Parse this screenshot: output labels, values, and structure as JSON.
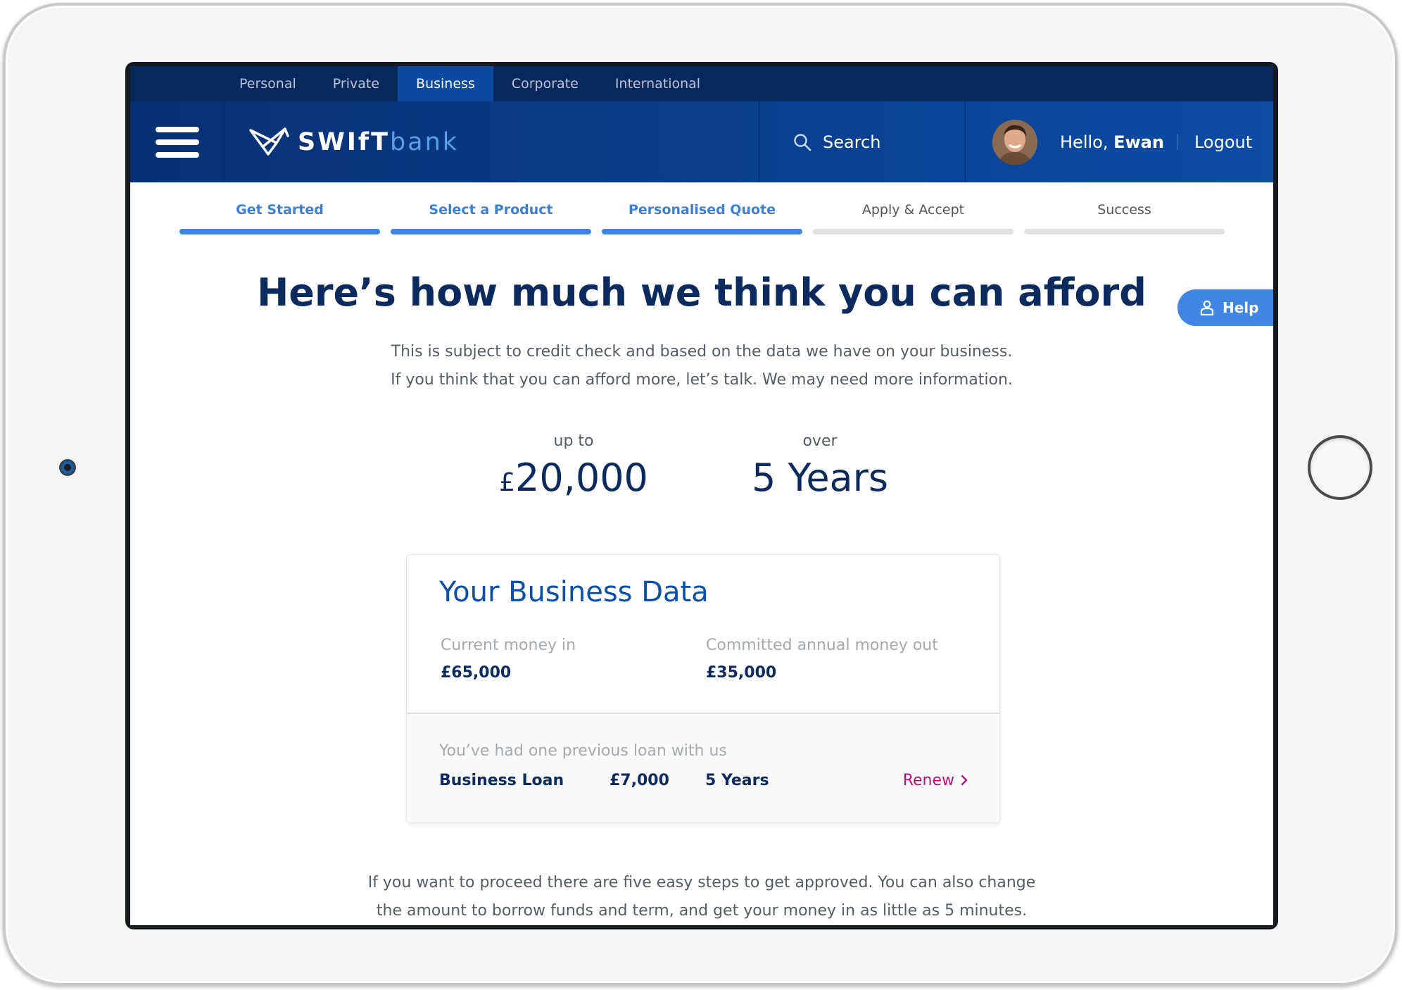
{
  "top_nav": {
    "items": [
      {
        "label": "Personal",
        "active": false
      },
      {
        "label": "Private",
        "active": false
      },
      {
        "label": "Business",
        "active": true
      },
      {
        "label": "Corporate",
        "active": false
      },
      {
        "label": "International",
        "active": false
      }
    ]
  },
  "header": {
    "brand_primary": "SWIfT",
    "brand_secondary": "bank",
    "search_label": "Search",
    "greeting": "Hello,",
    "user_name": "Ewan",
    "logout_label": "Logout"
  },
  "progress": {
    "steps": [
      {
        "label": "Get Started",
        "complete": true
      },
      {
        "label": "Select a Product",
        "complete": true
      },
      {
        "label": "Personalised Quote",
        "complete": true
      },
      {
        "label": "Apply & Accept",
        "complete": false
      },
      {
        "label": "Success",
        "complete": false
      }
    ]
  },
  "help": {
    "label": "Help"
  },
  "main": {
    "headline": "Here’s how much we think you can afford",
    "subtext_line1": "This is subject to credit check and based on the data we have on your business.",
    "subtext_line2": "If you think that you can afford more, let’s talk. We may need more information.",
    "amount_prefix": "up to",
    "amount_currency": "£",
    "amount_value": "20,000",
    "term_prefix": "over",
    "term_value": "5 Years"
  },
  "business_data": {
    "title": "Your Business Data",
    "money_in_label": "Current money in",
    "money_in_value": "£65,000",
    "money_out_label": "Committed annual money out",
    "money_out_value": "£35,000",
    "previous_label": "You’ve had one previous loan with us",
    "loan_type": "Business Loan",
    "loan_amount": "£7,000",
    "loan_term": "5 Years",
    "renew_label": "Renew"
  },
  "footer": {
    "line1": "If you want to proceed there are five easy steps to get approved. You can also change",
    "line2": "the amount to borrow funds and term, and get your money in as little as 5 minutes."
  },
  "colors": {
    "navy": "#0b2b5e",
    "header_blue": "#0a3f8e",
    "accent_blue": "#3d86e0",
    "renew_magenta": "#b5137a"
  }
}
